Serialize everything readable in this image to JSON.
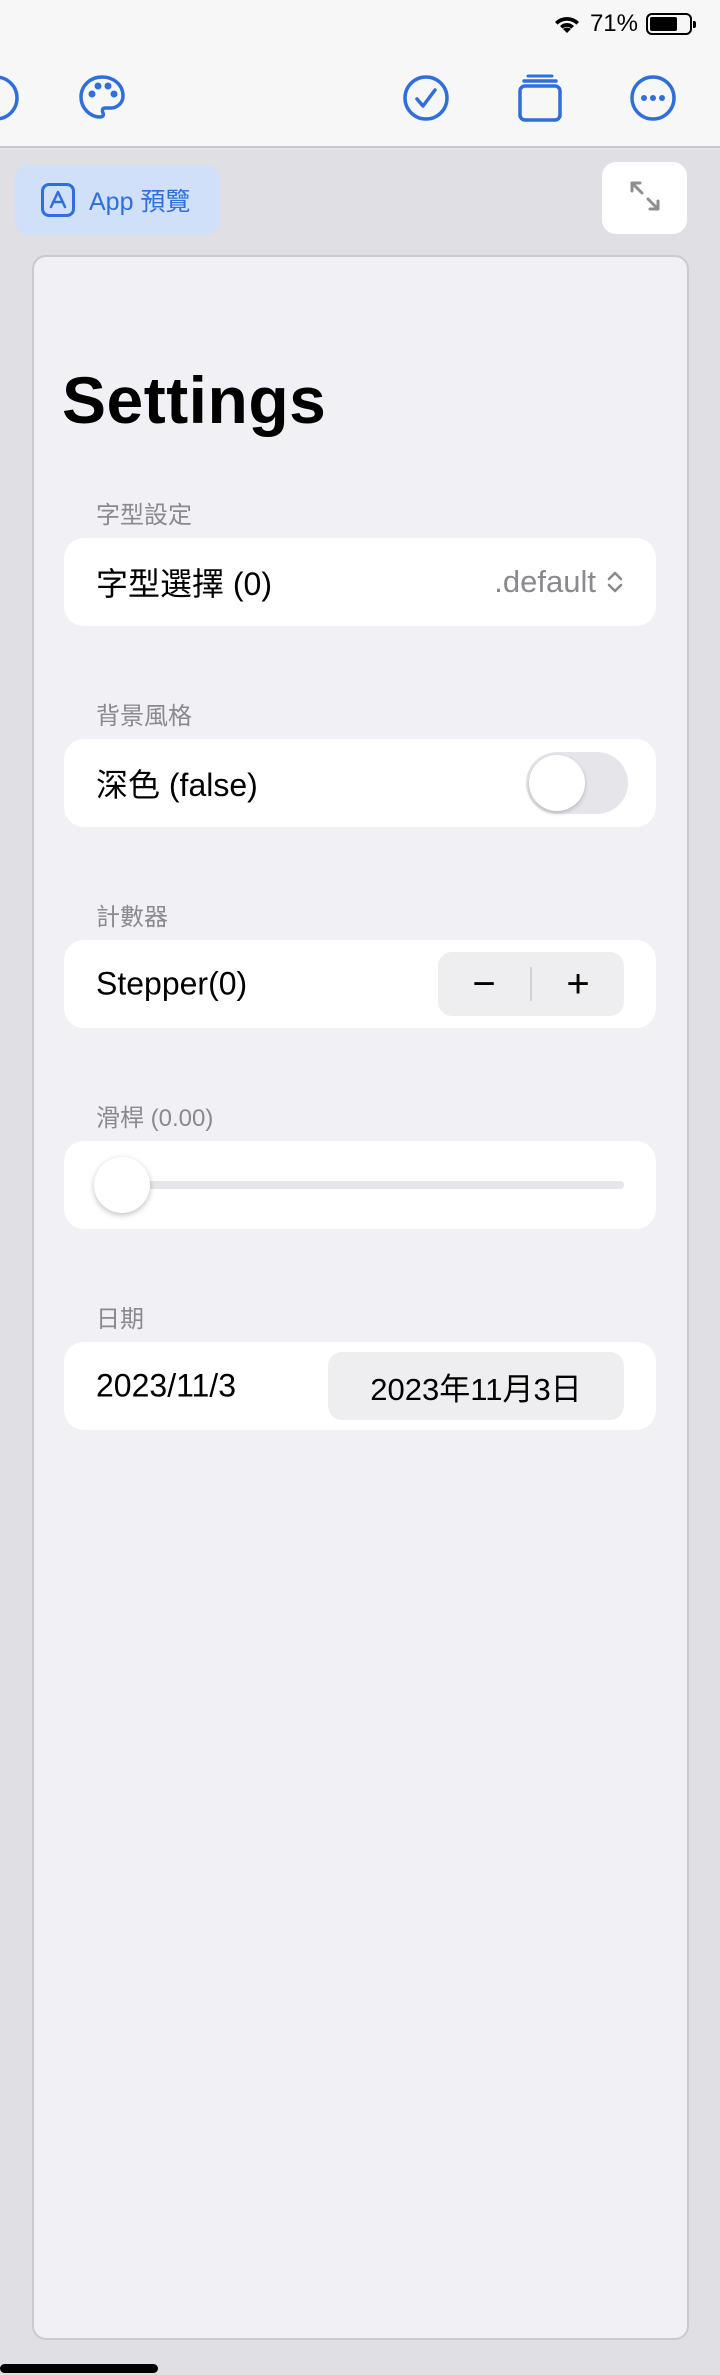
{
  "status": {
    "battery_percent": "71%",
    "battery_level": 0.71
  },
  "toolbar": {
    "icons": [
      "palette-icon",
      "checkmark-circle-icon",
      "pages-icon",
      "more-icon"
    ]
  },
  "preview_badge": {
    "label": "App 預覽"
  },
  "settings": {
    "title": "Settings",
    "font_section": {
      "header": "字型設定",
      "label": "字型選擇 (0)",
      "value": ".default"
    },
    "background_section": {
      "header": "背景風格",
      "label": "深色 (false)",
      "toggle_on": false
    },
    "counter_section": {
      "header": "計數器",
      "label": "Stepper(0)",
      "minus": "−",
      "plus": "+"
    },
    "slider_section": {
      "header": "滑桿 (0.00)",
      "value": 0.0
    },
    "date_section": {
      "header": "日期",
      "label": "2023/11/3",
      "value": "2023年11月3日"
    }
  },
  "colors": {
    "accent": "#2f6fdc",
    "panel": "#f0f0f5",
    "secondary_text": "#8a8a8e"
  }
}
